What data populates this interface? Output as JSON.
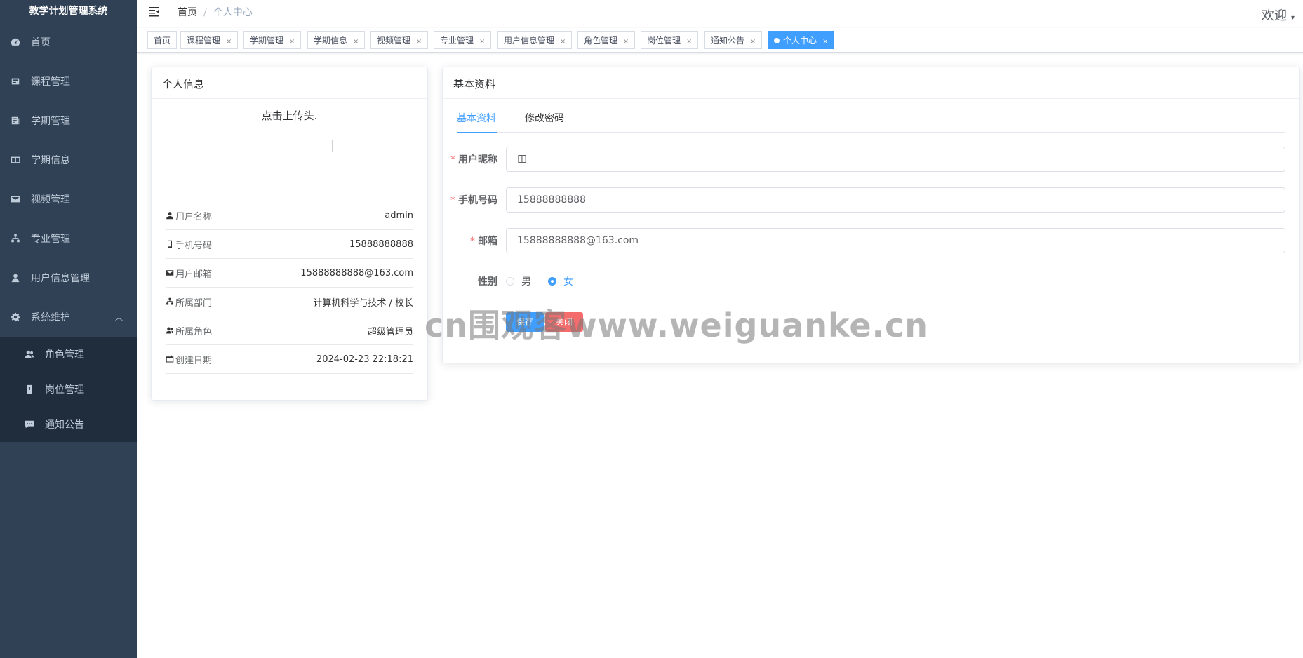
{
  "app": {
    "title": "教学计划管理系统"
  },
  "sidebar": {
    "items": [
      {
        "label": "首页",
        "icon": "dashboard-icon"
      },
      {
        "label": "课程管理",
        "icon": "course-icon"
      },
      {
        "label": "学期管理",
        "icon": "term-icon"
      },
      {
        "label": "学期信息",
        "icon": "book-icon"
      },
      {
        "label": "视频管理",
        "icon": "mail-icon"
      },
      {
        "label": "专业管理",
        "icon": "tree-icon"
      },
      {
        "label": "用户信息管理",
        "icon": "user-icon"
      },
      {
        "label": "系统维护",
        "icon": "gear-icon"
      }
    ],
    "subitems": [
      {
        "label": "角色管理",
        "icon": "peoples-icon"
      },
      {
        "label": "岗位管理",
        "icon": "post-icon"
      },
      {
        "label": "通知公告",
        "icon": "message-icon"
      }
    ]
  },
  "navbar": {
    "breadcrumb_home": "首页",
    "breadcrumb_sep": "/",
    "breadcrumb_current": "个人中心",
    "welcome": "欢迎",
    "caret": "▾"
  },
  "tags": [
    {
      "label": "首页",
      "closable": false
    },
    {
      "label": "课程管理",
      "closable": true
    },
    {
      "label": "学期管理",
      "closable": true
    },
    {
      "label": "学期信息",
      "closable": true
    },
    {
      "label": "视频管理",
      "closable": true
    },
    {
      "label": "专业管理",
      "closable": true
    },
    {
      "label": "用户信息管理",
      "closable": true
    },
    {
      "label": "角色管理",
      "closable": true
    },
    {
      "label": "岗位管理",
      "closable": true
    },
    {
      "label": "通知公告",
      "closable": true
    },
    {
      "label": "个人中心",
      "closable": true,
      "active": true
    }
  ],
  "tag_close": "×",
  "profile_card": {
    "title": "个人信息",
    "avatar_hint": "点击上传头.",
    "rows": [
      {
        "label": "用户名称",
        "value": "admin",
        "icon": "user-icon"
      },
      {
        "label": "手机号码",
        "value": "15888888888",
        "icon": "phone-icon"
      },
      {
        "label": "用户邮箱",
        "value": "15888888888@163.com",
        "icon": "email-icon"
      },
      {
        "label": "所属部门",
        "value": "计算机科学与技术 / 校长",
        "icon": "tree-icon"
      },
      {
        "label": "所属角色",
        "value": "超级管理员",
        "icon": "peoples-icon"
      },
      {
        "label": "创建日期",
        "value": "2024-02-23 22:18:21",
        "icon": "date-icon"
      }
    ]
  },
  "basic_card": {
    "title": "基本资料",
    "tabs": [
      "基本资料",
      "修改密码"
    ],
    "fields": {
      "nickname": {
        "label": "用户昵称",
        "value": "田"
      },
      "phone": {
        "label": "手机号码",
        "value": "15888888888"
      },
      "email": {
        "label": "邮箱",
        "value": "15888888888@163.com"
      }
    },
    "required_mark": "*",
    "gender": {
      "label": "性别",
      "options": [
        "男",
        "女"
      ],
      "selected": "女"
    },
    "buttons": {
      "save": "保存",
      "close": "关闭"
    }
  },
  "watermark": "cn围观客www.weiguanke.cn",
  "colors": {
    "sidebar_bg": "#304156",
    "submenu_bg": "#1f2d3d",
    "primary": "#409eff",
    "danger": "#f56c6c"
  }
}
